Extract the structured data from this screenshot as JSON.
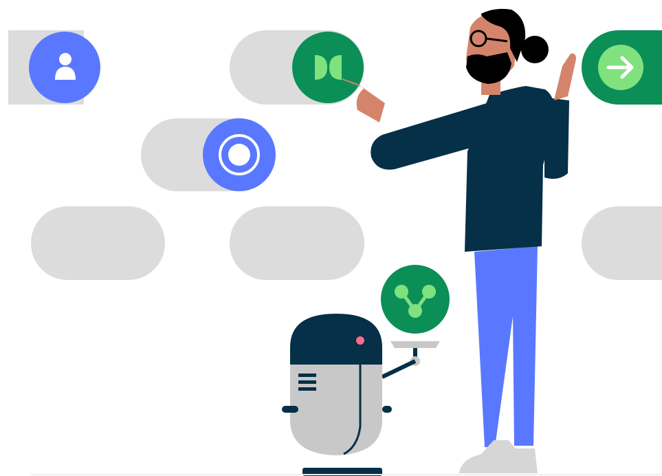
{
  "colors": {
    "background": "#ffffff",
    "pill_gray": "#dcdcdc",
    "blue": "#5a78ff",
    "green": "#0b8f57",
    "light_green": "#7fe27f",
    "navy": "#062f48",
    "skin": "#d4846a",
    "robot_gray": "#c8c8c8",
    "shoe_gray": "#d6d6d6",
    "robot_eye": "#ff6b8b"
  },
  "toggles": [
    {
      "icon": "person-icon",
      "state": "on"
    },
    {
      "icon": "d-shape-icon",
      "state": "on"
    },
    {
      "icon": "radio-target-icon",
      "state": "on"
    },
    {
      "icon": "arrow-right-icon",
      "state": "on"
    },
    {
      "icon": "",
      "state": "off"
    },
    {
      "icon": "",
      "state": "off"
    },
    {
      "icon": "",
      "state": "off"
    }
  ],
  "robot": {
    "tray_icon": "share-network-icon"
  }
}
